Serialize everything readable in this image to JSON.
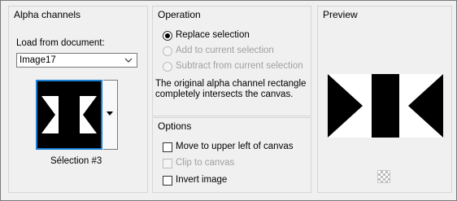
{
  "alpha": {
    "title": "Alpha channels",
    "load_label": "Load from document:",
    "document_value": "Image17",
    "selection_name": "Sélection #3"
  },
  "operation": {
    "title": "Operation",
    "options": [
      {
        "label": "Replace selection",
        "selected": true,
        "enabled": true
      },
      {
        "label": "Add to current selection",
        "selected": false,
        "enabled": false
      },
      {
        "label": "Subtract from current selection",
        "selected": false,
        "enabled": false
      }
    ],
    "note": "The original alpha channel rectangle completely intersects the canvas."
  },
  "options": {
    "title": "Options",
    "items": [
      {
        "label": "Move to upper left of canvas",
        "checked": false,
        "enabled": true
      },
      {
        "label": "Clip to canvas",
        "checked": false,
        "enabled": false
      },
      {
        "label": "Invert image",
        "checked": false,
        "enabled": true
      }
    ]
  },
  "preview": {
    "title": "Preview"
  },
  "colors": {
    "accent": "#1a80d6",
    "disabled": "#a0a0a0"
  }
}
